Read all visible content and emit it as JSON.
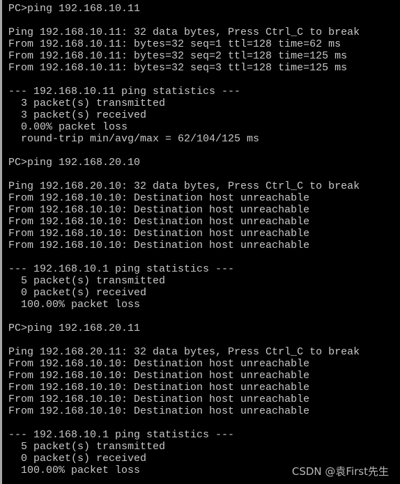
{
  "terminal": {
    "lines": [
      "PC>ping 192.168.10.11",
      "",
      "Ping 192.168.10.11: 32 data bytes, Press Ctrl_C to break",
      "From 192.168.10.11: bytes=32 seq=1 ttl=128 time=62 ms",
      "From 192.168.10.11: bytes=32 seq=2 ttl=128 time=125 ms",
      "From 192.168.10.11: bytes=32 seq=3 ttl=128 time=125 ms",
      "",
      "--- 192.168.10.11 ping statistics ---",
      "  3 packet(s) transmitted",
      "  3 packet(s) received",
      "  0.00% packet loss",
      "  round-trip min/avg/max = 62/104/125 ms",
      "",
      "PC>ping 192.168.20.10",
      "",
      "Ping 192.168.20.10: 32 data bytes, Press Ctrl_C to break",
      "From 192.168.10.10: Destination host unreachable",
      "From 192.168.10.10: Destination host unreachable",
      "From 192.168.10.10: Destination host unreachable",
      "From 192.168.10.10: Destination host unreachable",
      "From 192.168.10.10: Destination host unreachable",
      "",
      "--- 192.168.10.1 ping statistics ---",
      "  5 packet(s) transmitted",
      "  0 packet(s) received",
      "  100.00% packet loss",
      "",
      "PC>ping 192.168.20.11",
      "",
      "Ping 192.168.20.11: 32 data bytes, Press Ctrl_C to break",
      "From 192.168.10.10: Destination host unreachable",
      "From 192.168.10.10: Destination host unreachable",
      "From 192.168.10.10: Destination host unreachable",
      "From 192.168.10.10: Destination host unreachable",
      "From 192.168.10.10: Destination host unreachable",
      "",
      "--- 192.168.10.1 ping statistics ---",
      "  5 packet(s) transmitted",
      "  0 packet(s) received",
      "  100.00% packet loss"
    ]
  },
  "watermark": "CSDN @袁First先生"
}
